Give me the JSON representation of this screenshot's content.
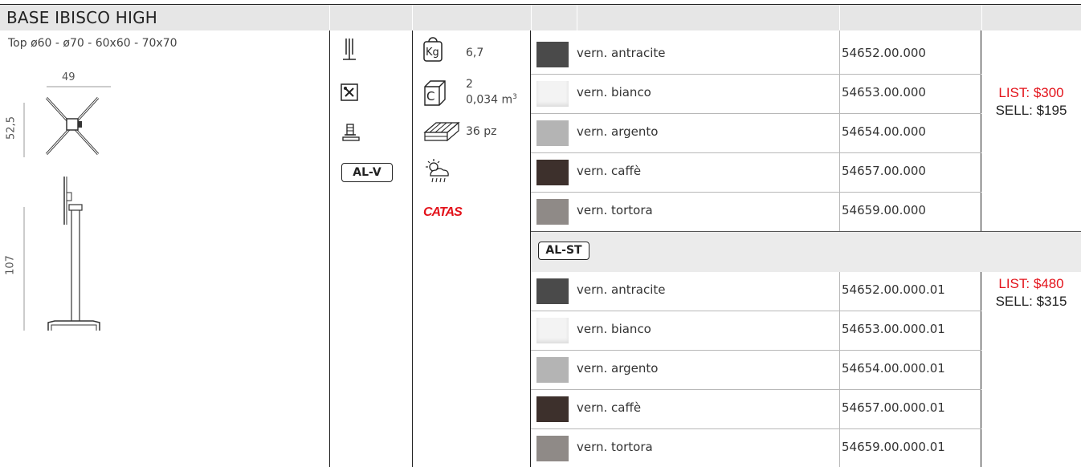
{
  "header": {
    "title": "BASE IBISCO HIGH"
  },
  "dimensions": {
    "top_sizes": "Top  ø60 - ø70 - 60x60 - 70x70",
    "width": "49",
    "depth": "52,5",
    "height": "107"
  },
  "specs": {
    "weight": "6,7",
    "weight_unit": "Kg",
    "packages": "2",
    "volume": "0,034 m",
    "volume_exp": "3",
    "volume_icon_letter": "C",
    "pallet": "36 pz",
    "cert": "CATAS",
    "material": "AL-V"
  },
  "al_v": {
    "rows": [
      {
        "name": "vern. antracite",
        "code": "54652.00.000",
        "color": "#4a4a4a"
      },
      {
        "name": "vern. bianco",
        "code": "54653.00.000",
        "color": "#f3f3f3"
      },
      {
        "name": "vern. argento",
        "code": "54654.00.000",
        "color": "#b4b4b4"
      },
      {
        "name": "vern. caffè",
        "code": "54657.00.000",
        "color": "#3d302c"
      },
      {
        "name": "vern. tortora",
        "code": "54659.00.000",
        "color": "#8f8a87"
      }
    ],
    "price_list": "LIST: $300",
    "price_sell": "SELL: $195"
  },
  "al_st": {
    "label": "AL-ST",
    "rows": [
      {
        "name": "vern. antracite",
        "code": "54652.00.000.01",
        "color": "#4a4a4a"
      },
      {
        "name": "vern. bianco",
        "code": "54653.00.000.01",
        "color": "#f3f3f3"
      },
      {
        "name": "vern. argento",
        "code": "54654.00.000.01",
        "color": "#b4b4b4"
      },
      {
        "name": "vern. caffè",
        "code": "54657.00.000.01",
        "color": "#3d302c"
      },
      {
        "name": "vern. tortora",
        "code": "54659.00.000.01",
        "color": "#8f8a87"
      }
    ],
    "price_list": "LIST: $480",
    "price_sell": "SELL: $315"
  },
  "colors": {
    "accent_red": "#e3131b",
    "header_bg": "#e6e6e6"
  }
}
